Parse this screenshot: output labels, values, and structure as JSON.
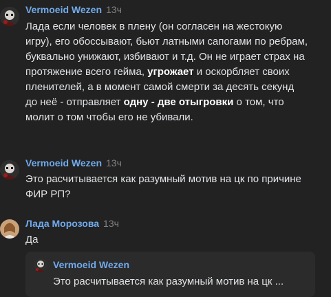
{
  "messages": [
    {
      "author": "Vermoeid Wezen",
      "time": "13ч",
      "avatar_icon": "masked-figure-avatar",
      "text_segments": [
        {
          "text": "Лада если человек в плену (он согласен на жестокую игру), его обоссывают, бьют латными сапогами по ребрам, буквально унижают, избивают и т.д. Он не играет страх на протяжение всего гейма,  ",
          "bold": false
        },
        {
          "text": "угрожает",
          "bold": true
        },
        {
          "text": " и оскорбляет своих пленителей, а в момент самой смерти за десять секунд до неё  - отправляет ",
          "bold": false
        },
        {
          "text": "одну - две отыгровки",
          "bold": true
        },
        {
          "text": " о том, что молит о том чтобы его не убивали.",
          "bold": false
        }
      ]
    },
    {
      "author": "Vermoeid Wezen",
      "time": "13ч",
      "avatar_icon": "masked-figure-avatar",
      "text": "Это расчитывается как разумный мотив на цк по причине ФИР РП?"
    },
    {
      "author": "Лада Морозова",
      "time": "13ч",
      "avatar_icon": "user-photo-avatar",
      "text": "Да",
      "reply": {
        "author": "Vermoeid Wezen",
        "text": "Это расчитывается как разумный мотив на цк ..."
      }
    }
  ],
  "colors": {
    "background": "#222222",
    "author_link": "#71aaeb",
    "timestamp": "#828282",
    "text": "#e1e3e6",
    "reply_background": "#2b2b2b"
  }
}
